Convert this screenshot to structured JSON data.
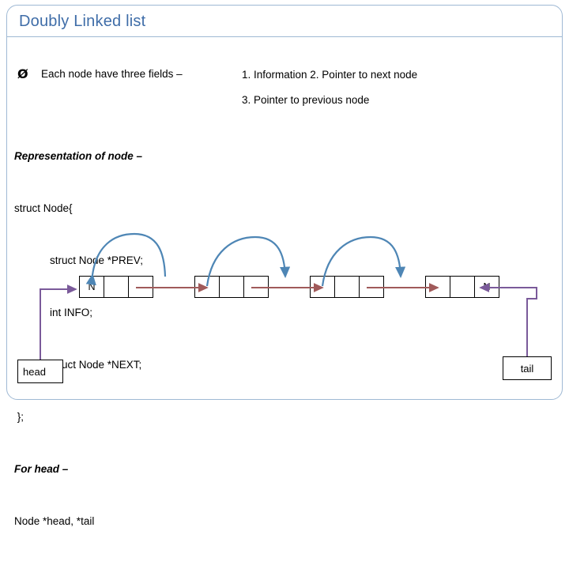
{
  "slide": {
    "title": "Doubly Linked list",
    "bullet": {
      "marker": "Ø",
      "text": "Each node have three fields –",
      "right_line1": "1. Information   2. Pointer to next node",
      "right_line2": "3. Pointer to previous node"
    },
    "code": {
      "line1": "Representation of node –",
      "line2": "struct Node{",
      "line3": "            struct Node *PREV;",
      "line4": "            int INFO;",
      "line5": "            struct Node *NEXT;",
      "line6": " };",
      "line7": "For head –",
      "line8": "Node *head, *tail"
    },
    "diagram": {
      "node1": {
        "cell1": "N",
        "cell2": "",
        "cell3": ""
      },
      "node2": {
        "cell1": "",
        "cell2": "",
        "cell3": ""
      },
      "node3": {
        "cell1": "",
        "cell2": "",
        "cell3": ""
      },
      "node4": {
        "cell1": "",
        "cell2": "",
        "cell3": "N"
      },
      "head_label": "head",
      "tail_label": "tail"
    },
    "colors": {
      "title": "#3f6da8",
      "frame": "#9fb9d4",
      "next_arrow": "#a05a5a",
      "prev_arrow": "#4e86b5",
      "head_arrow": "#7a5a9a",
      "tail_arrow": "#7a5a9a"
    }
  }
}
